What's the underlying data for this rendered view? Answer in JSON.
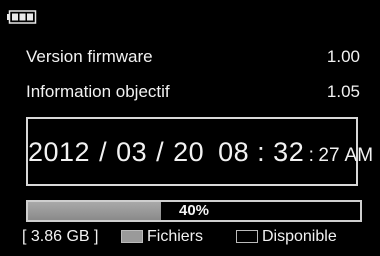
{
  "status": {
    "battery_icon": "battery-full-icon"
  },
  "info": {
    "firmware_label": "Version firmware",
    "firmware_value": "1.00",
    "lens_label": "Information objectif",
    "lens_value": "1.05"
  },
  "datetime": {
    "date": "2012 / 03 / 20",
    "hour_minute": "08 : 32",
    "seconds_separator": ":",
    "seconds": "27",
    "ampm": "AM"
  },
  "storage": {
    "percent_text": "40%",
    "percent": 0.4,
    "capacity_text": "[ 3.86 GB ]",
    "legend_files": "Fichiers",
    "legend_free": "Disponible",
    "files_color": "#9a9a9a",
    "free_color": "#000000"
  }
}
